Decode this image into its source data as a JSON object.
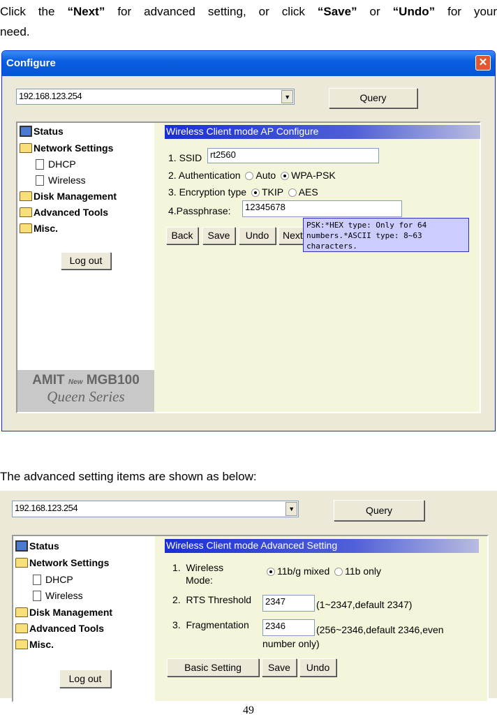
{
  "intro": {
    "pre": "Click the ",
    "next": "“Next”",
    "mid1": " for advanced setting, or click ",
    "save": "“Save”",
    "mid2": " or ",
    "undo": "“Undo”",
    "post": " for your need."
  },
  "caption2": "The advanced setting items are shown as below:",
  "page_number": "49",
  "shot1": {
    "title": "Configure",
    "close": "✕",
    "address": "192.168.123.254",
    "query": "Query",
    "tree": [
      "Status",
      "Network Settings",
      "DHCP",
      "Wireless",
      "Disk Management",
      "Advanced Tools",
      "Misc."
    ],
    "logout": "Log out",
    "logo": {
      "brand": "AMIT",
      "new": "New",
      "model": "MGB100",
      "series": "Queen Series"
    },
    "header": "Wireless Client mode AP Configure",
    "ssid_label": "1. SSID",
    "ssid": "rt2560",
    "auth_label": "2. Authentication",
    "auth_options": [
      "Auto",
      "WPA-PSK"
    ],
    "auth_selected": "WPA-PSK",
    "enc_label": "3. Encryption type",
    "enc_options": [
      "TKIP",
      "AES"
    ],
    "enc_selected": "TKIP",
    "pass_label": "4.Passphrase:",
    "pass": "12345678",
    "buttons": [
      "Back",
      "Save",
      "Undo",
      "Next"
    ],
    "tooltip": "PSK:*HEX type: Only for 64 numbers.*ASCII type: 8~63 characters."
  },
  "shot2": {
    "address": "192.168.123.254",
    "query": "Query",
    "tree": [
      "Status",
      "Network Settings",
      "DHCP",
      "Wireless",
      "Disk Management",
      "Advanced Tools",
      "Misc."
    ],
    "logout": "Log out",
    "header": "Wireless Client mode Advanced Setting",
    "mode_label_1": "1.  Wireless",
    "mode_label_2": "Mode:",
    "mode_options": [
      "11b/g mixed",
      "11b only"
    ],
    "mode_selected": "11b/g mixed",
    "rts_label": "2.  RTS Threshold",
    "rts": "2347",
    "rts_note": "(1~2347,default 2347)",
    "frag_label": "3.  Fragmentation",
    "frag": "2346",
    "frag_note_1": "(256~2346,default 2346,even",
    "frag_note_2": "number only)",
    "buttons": [
      "Basic Setting",
      "Save",
      "Undo"
    ]
  },
  "colors": {
    "title_bar": "#0a5ee0",
    "content_bg": "#f5f5dc",
    "header_bar": "#1a2ed8",
    "tooltip_bg": "#ccccff"
  }
}
